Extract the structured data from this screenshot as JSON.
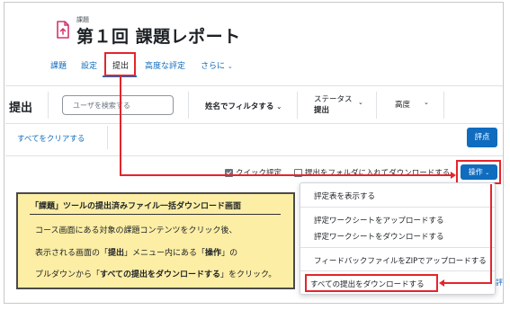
{
  "header": {
    "overline": "課題",
    "title": "第１回 課題レポート",
    "icon": "assignment-doc-icon"
  },
  "tabs": [
    {
      "label": "課題",
      "active": false
    },
    {
      "label": "設定",
      "active": false
    },
    {
      "label": "提出",
      "active": true
    },
    {
      "label": "高度な評定",
      "active": false
    },
    {
      "label": "さらに",
      "active": false
    }
  ],
  "filters": {
    "title": "提出",
    "search_placeholder": "ユーザを検索する",
    "name_filter_label": "姓名でフィルタする",
    "status_label": "ステータス",
    "status_value": "提出",
    "advanced_label": "高度"
  },
  "actions": {
    "clear_all": "すべてをクリアする",
    "grade_button": "評点",
    "quick_grading": "クイック評定",
    "quick_grading_checked": true,
    "download_zip_folders": "提出をフォルダに入れてダウンロードする",
    "download_zip_folders_checked": false,
    "operations_button": "操作"
  },
  "menu": {
    "items": [
      "評定表を表示する",
      "評定ワークシートをアップロードする",
      "評定ワークシートをダウンロードする",
      "フィードバックファイルをZIPでアップロードする",
      "すべての提出をダウンロードする"
    ],
    "edge_text": "評"
  },
  "annotation": {
    "title": "「課題」ツールの提出済みファイル一括ダウンロード画面",
    "line1": "コース画面にある対象の課題コンテンツをクリック後、",
    "line2_a": "表示される画面の「",
    "line2_b": "提出",
    "line2_c": "」メニュー内にある「",
    "line2_d": "操作",
    "line2_e": "」の",
    "line3_a": "プルダウンから「",
    "line3_b": "すべての提出をダウンロードする",
    "line3_c": "」をクリック。"
  },
  "colors": {
    "accent": "#0f6cbf",
    "highlight": "#e4252b",
    "note_bg": "#fdeea5",
    "icon_pink": "#d6336c"
  }
}
